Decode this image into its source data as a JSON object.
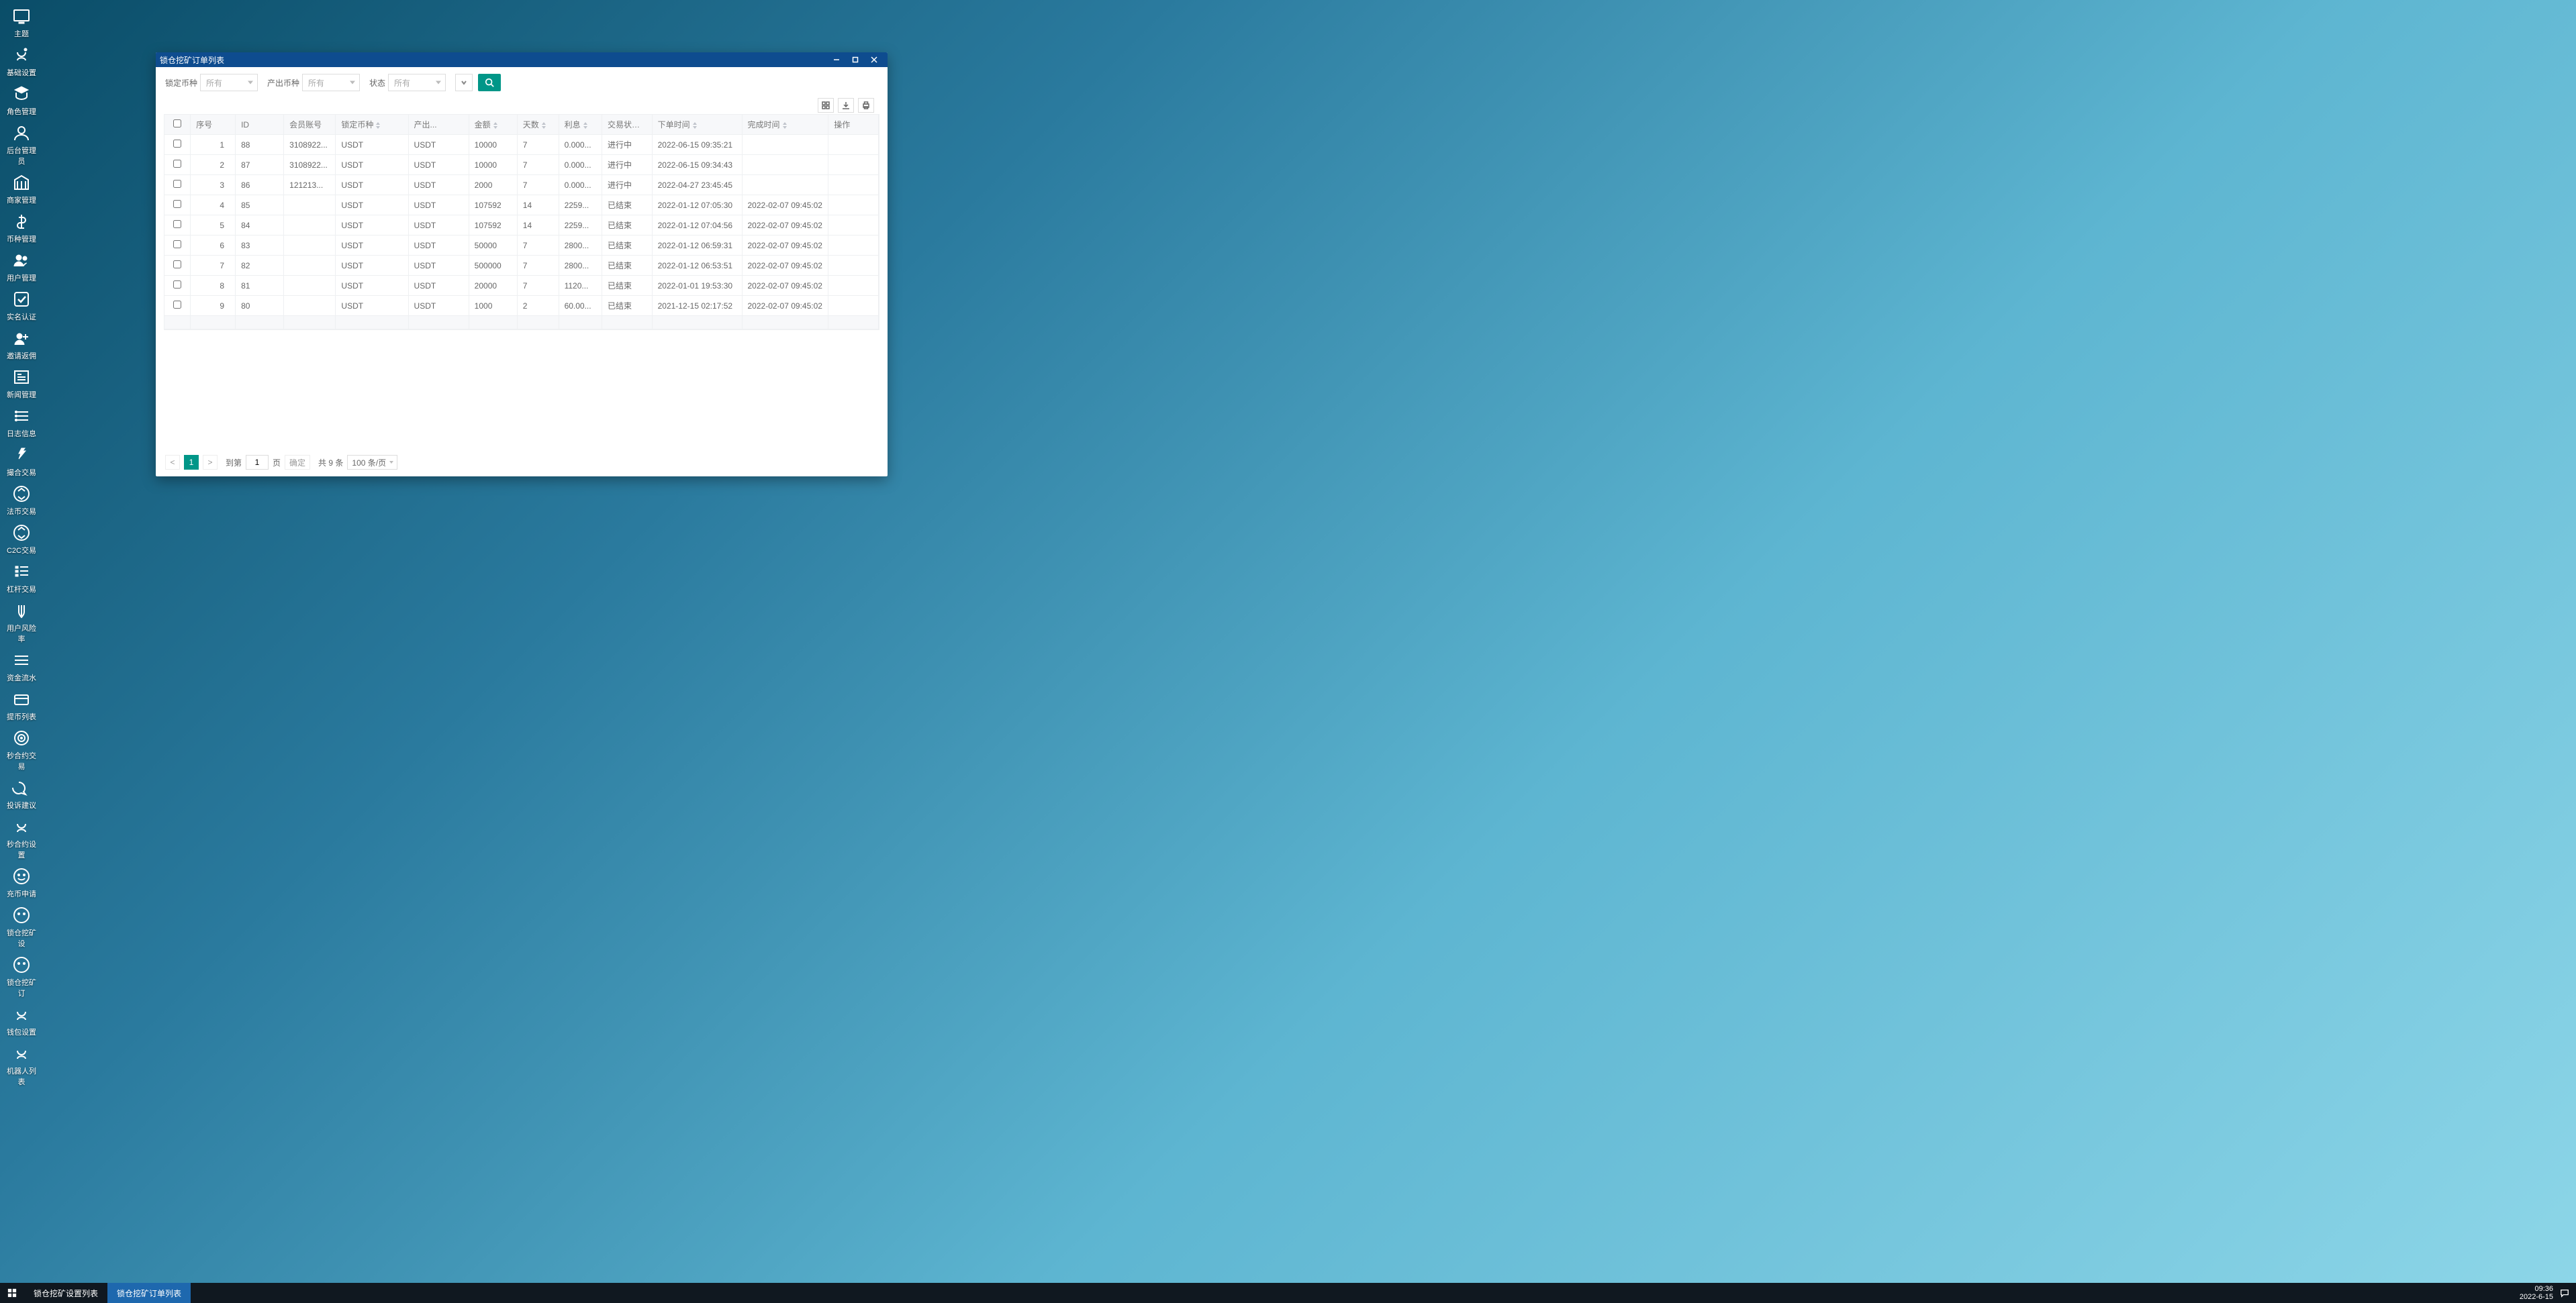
{
  "desktop_icons_col1": [
    {
      "label": "主题",
      "name": "theme"
    },
    {
      "label": "基础设置",
      "name": "basic-settings"
    },
    {
      "label": "角色管理",
      "name": "role-management"
    },
    {
      "label": "后台管理员",
      "name": "backend-admin"
    },
    {
      "label": "商家管理",
      "name": "merchant-management"
    },
    {
      "label": "币种管理",
      "name": "coin-management"
    },
    {
      "label": "用户管理",
      "name": "user-management"
    },
    {
      "label": "实名认证",
      "name": "real-name-auth"
    },
    {
      "label": "邀请返佣",
      "name": "invite-rebate"
    },
    {
      "label": "新闻管理",
      "name": "news-management"
    },
    {
      "label": "日志信息",
      "name": "log-info"
    },
    {
      "label": "撮合交易",
      "name": "matching-trade"
    },
    {
      "label": "法币交易",
      "name": "fiat-trade"
    }
  ],
  "desktop_icons_col2": [
    {
      "label": "C2C交易",
      "name": "c2c-trade"
    },
    {
      "label": "杠杆交易",
      "name": "leverage-trade"
    },
    {
      "label": "用户风险率",
      "name": "user-risk-rate"
    },
    {
      "label": "资金流水",
      "name": "fund-flow"
    },
    {
      "label": "提币列表",
      "name": "withdraw-list"
    },
    {
      "label": "秒合约交易",
      "name": "second-contract-trade"
    },
    {
      "label": "投诉建议",
      "name": "complaint-suggestion"
    },
    {
      "label": "秒合约设置",
      "name": "second-contract-setting"
    },
    {
      "label": "充币申请",
      "name": "deposit-apply"
    },
    {
      "label": "锁仓挖矿设",
      "name": "lock-mining-setting"
    },
    {
      "label": "锁仓挖矿订",
      "name": "lock-mining-order"
    },
    {
      "label": "钱包设置",
      "name": "wallet-setting"
    },
    {
      "label": "机器人列表",
      "name": "robot-list"
    }
  ],
  "window": {
    "title": "锁仓挖矿订单列表",
    "filters": {
      "lock_coin_label": "锁定币种",
      "lock_coin_value": "所有",
      "out_coin_label": "产出币种",
      "out_coin_value": "所有",
      "status_label": "状态",
      "status_value": "所有"
    },
    "columns": {
      "seq": "序号",
      "id": "ID",
      "member": "会员账号",
      "lock_coin": "锁定币种",
      "out_coin": "产出...",
      "amount": "金额",
      "days": "天数",
      "interest": "利息",
      "trade_status": "交易状态...",
      "order_time": "下单时间",
      "finish_time": "完成时间",
      "ops": "操作"
    },
    "rows": [
      {
        "seq": "1",
        "id": "88",
        "member": "3108922...",
        "lock": "USDT",
        "out": "USDT",
        "amount": "10000",
        "days": "7",
        "interest": "0.000...",
        "status": "进行中",
        "otime": "2022-06-15 09:35:21",
        "ftime": ""
      },
      {
        "seq": "2",
        "id": "87",
        "member": "3108922...",
        "lock": "USDT",
        "out": "USDT",
        "amount": "10000",
        "days": "7",
        "interest": "0.000...",
        "status": "进行中",
        "otime": "2022-06-15 09:34:43",
        "ftime": ""
      },
      {
        "seq": "3",
        "id": "86",
        "member": "121213...",
        "lock": "USDT",
        "out": "USDT",
        "amount": "2000",
        "days": "7",
        "interest": "0.000...",
        "status": "进行中",
        "otime": "2022-04-27 23:45:45",
        "ftime": ""
      },
      {
        "seq": "4",
        "id": "85",
        "member": "",
        "lock": "USDT",
        "out": "USDT",
        "amount": "107592",
        "days": "14",
        "interest": "2259...",
        "status": "已结束",
        "otime": "2022-01-12 07:05:30",
        "ftime": "2022-02-07 09:45:02"
      },
      {
        "seq": "5",
        "id": "84",
        "member": "",
        "lock": "USDT",
        "out": "USDT",
        "amount": "107592",
        "days": "14",
        "interest": "2259...",
        "status": "已结束",
        "otime": "2022-01-12 07:04:56",
        "ftime": "2022-02-07 09:45:02"
      },
      {
        "seq": "6",
        "id": "83",
        "member": "",
        "lock": "USDT",
        "out": "USDT",
        "amount": "50000",
        "days": "7",
        "interest": "2800...",
        "status": "已结束",
        "otime": "2022-01-12 06:59:31",
        "ftime": "2022-02-07 09:45:02"
      },
      {
        "seq": "7",
        "id": "82",
        "member": "",
        "lock": "USDT",
        "out": "USDT",
        "amount": "500000",
        "days": "7",
        "interest": "2800...",
        "status": "已结束",
        "otime": "2022-01-12 06:53:51",
        "ftime": "2022-02-07 09:45:02"
      },
      {
        "seq": "8",
        "id": "81",
        "member": "",
        "lock": "USDT",
        "out": "USDT",
        "amount": "20000",
        "days": "7",
        "interest": "1120...",
        "status": "已结束",
        "otime": "2022-01-01 19:53:30",
        "ftime": "2022-02-07 09:45:02"
      },
      {
        "seq": "9",
        "id": "80",
        "member": "",
        "lock": "USDT",
        "out": "USDT",
        "amount": "1000",
        "days": "2",
        "interest": "60.00...",
        "status": "已结束",
        "otime": "2021-12-15 02:17:52",
        "ftime": "2022-02-07 09:45:02"
      }
    ],
    "pager": {
      "current": "1",
      "goto_label": "到第",
      "page_label": "页",
      "confirm": "确定",
      "total": "共 9 条",
      "size": "100 条/页",
      "goto_input": "1"
    }
  },
  "taskbar": {
    "task1": "锁仓挖矿设置列表",
    "task2": "锁仓挖矿订单列表",
    "time": "09:36",
    "date": "2022-6-15"
  }
}
